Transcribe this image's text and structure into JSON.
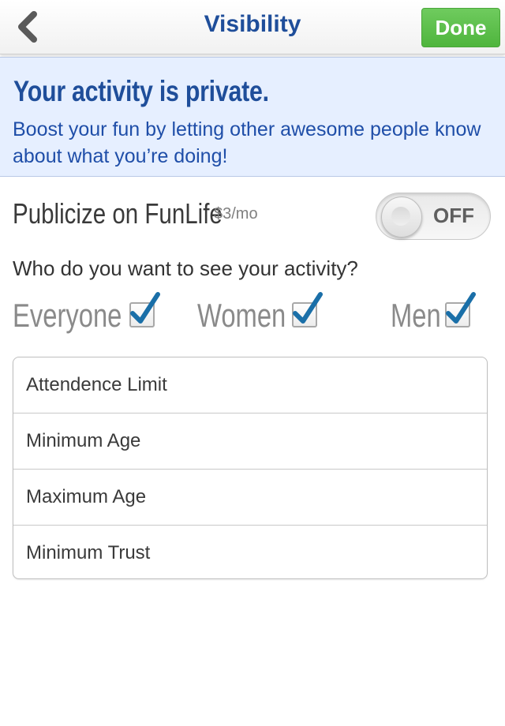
{
  "header": {
    "title": "Visibility",
    "done_label": "Done"
  },
  "banner": {
    "title": "Your activity is private.",
    "text": "Boost your fun by letting other awesome people know about what you’re doing!"
  },
  "publicize": {
    "label": "Publicize on FunLife",
    "price": "$3/mo",
    "toggle_state": "OFF"
  },
  "audience": {
    "question": "Who do you want to see your activity?",
    "options": [
      {
        "label": "Everyone",
        "checked": true
      },
      {
        "label": "Women",
        "checked": true
      },
      {
        "label": "Men",
        "checked": true
      }
    ]
  },
  "fields": [
    {
      "placeholder": "Attendence Limit",
      "value": ""
    },
    {
      "placeholder": "Minimum Age",
      "value": ""
    },
    {
      "placeholder": "Maximum Age",
      "value": ""
    },
    {
      "placeholder": "Minimum Trust",
      "value": ""
    }
  ],
  "colors": {
    "title_blue": "#1f4e9a",
    "banner_bg": "#e6efff",
    "done_green": "#57bb46",
    "check_blue": "#1a6fa8"
  },
  "icons": {
    "back": "chevron-left-icon",
    "check": "checkmark-icon"
  }
}
